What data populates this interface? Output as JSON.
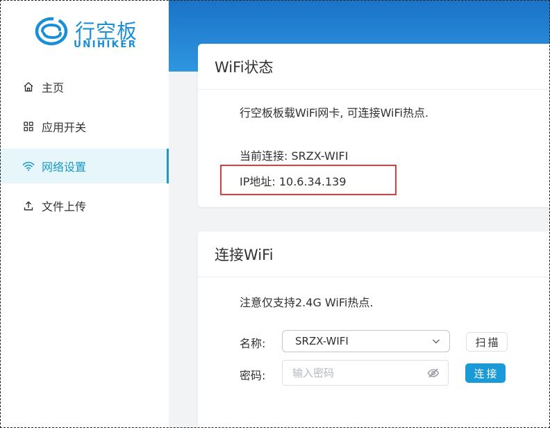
{
  "logo": {
    "cn": "行空板",
    "en": "UNIHIKER"
  },
  "sidebar": {
    "items": [
      {
        "label": "主页",
        "icon": "home-icon",
        "active": false
      },
      {
        "label": "应用开关",
        "icon": "grid-icon",
        "active": false
      },
      {
        "label": "网络设置",
        "icon": "wifi-icon",
        "active": true
      },
      {
        "label": "文件上传",
        "icon": "upload-icon",
        "active": false
      }
    ]
  },
  "wifi_status": {
    "title": "WiFi状态",
    "description": "行空板板载WiFi网卡, 可连接WiFi热点.",
    "current_connection": "当前连接: SRZX-WIFI",
    "ip_address": "IP地址: 10.6.34.139"
  },
  "connect_wifi": {
    "title": "连接WiFi",
    "note": "注意仅支持2.4G WiFi热点.",
    "name_label": "名称:",
    "name_value": "SRZX-WIFI",
    "password_label": "密码:",
    "password_placeholder": "输入密码",
    "scan_label": "扫描",
    "connect_label": "连接"
  },
  "colors": {
    "accent": "#1a9ac9",
    "banner": "#1a73c7",
    "highlight": "#e23b3b",
    "connect_button": "#1a9ad6"
  }
}
